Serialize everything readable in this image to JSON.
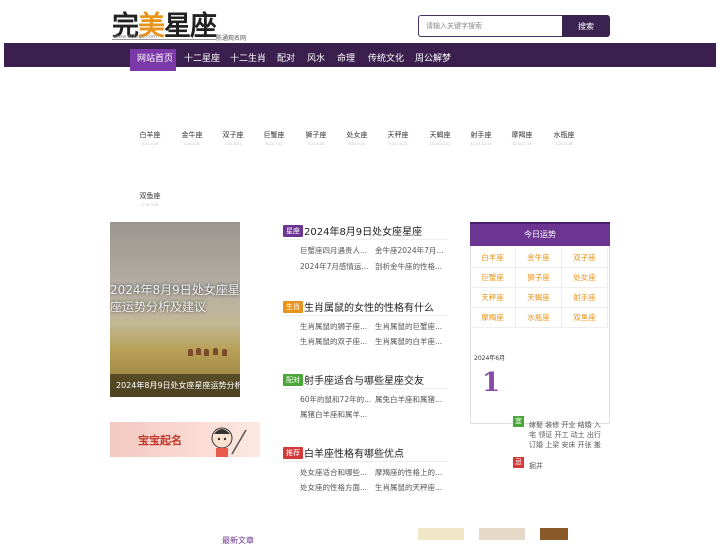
{
  "header": {
    "logo_left": "完",
    "logo_mid": "美",
    "logo_right": "星座",
    "logo_sub": "www.dubuju.com",
    "slogan": "陈通观名网",
    "search_placeholder": "请输入关键字搜索",
    "search_button": "搜索"
  },
  "nav": {
    "items": [
      "网站首页",
      "十二星座",
      "十二生肖",
      "配对",
      "风水",
      "命理",
      "传统文化",
      "周公解梦"
    ]
  },
  "zodiacs": [
    {
      "name": "白羊座",
      "date": "3.21-4.19"
    },
    {
      "name": "金牛座",
      "date": "4.20-5.20"
    },
    {
      "name": "双子座",
      "date": "5.21-6.21"
    },
    {
      "name": "巨蟹座",
      "date": "6.22-7.22"
    },
    {
      "name": "狮子座",
      "date": "7.23-8.22"
    },
    {
      "name": "处女座",
      "date": "8.23-9.22"
    },
    {
      "name": "天秤座",
      "date": "9.23-10.23"
    },
    {
      "name": "天蝎座",
      "date": "10.24-11.22"
    },
    {
      "name": "射手座",
      "date": "11.23-12.21"
    },
    {
      "name": "摩羯座",
      "date": "12.22-1.19"
    },
    {
      "name": "水瓶座",
      "date": "1.20-2.18"
    },
    {
      "name": "双鱼座",
      "date": "2.19-3.20"
    }
  ],
  "banner": {
    "big_text": "2024年8月9日处女座星座运势分析及建议",
    "caption": "2024年8月9日处女座星座运势分析及建议"
  },
  "ad": {
    "text": "宝宝起名"
  },
  "articles": [
    {
      "tag": "星座",
      "tag_color": "#6b3591",
      "title": "2024年8月9日处女座星座",
      "subs": [
        "巨蟹座四月遇贵人...",
        "金牛座2024年7月...",
        "2024年7月感情运...",
        "剖析金牛座的性格..."
      ]
    },
    {
      "tag": "生肖",
      "tag_color": "#e8941c",
      "title": "生肖属鼠的女性的性格有什么",
      "subs": [
        "生肖属鼠的狮子座...",
        "生肖属鼠的巨蟹座...",
        "生肖属鼠的双子座...",
        "生肖属鼠的白羊座..."
      ]
    },
    {
      "tag": "配对",
      "tag_color": "#4aa83a",
      "title": "射手座适合与哪些星座交友",
      "subs": [
        "60年的鼠和72年的...",
        "属兔白羊座和属猪...",
        "属猪白羊座和属羊..."
      ]
    },
    {
      "tag": "推荐",
      "tag_color": "#d23a3a",
      "title": "白羊座性格有哪些优点",
      "subs": [
        "处女座适合和哪些...",
        "摩羯座的性格上的...",
        "处女座的性格方面...",
        "生肖属鼠的天秤座..."
      ]
    }
  ],
  "fortune": {
    "title": "今日运势",
    "items": [
      "白羊座",
      "金牛座",
      "双子座",
      "巨蟹座",
      "狮子座",
      "处女座",
      "天秤座",
      "天蝎座",
      "射手座",
      "摩羯座",
      "水瓶座",
      "双鱼座"
    ]
  },
  "calendar": {
    "month": "2024年6月",
    "day": "1",
    "yi_label": "宜",
    "yi_text": "嫁娶 装修 开业 结婚 入宅 领证 开工 动土 出行 订婚 上梁 安床 开张 搬家",
    "ji_label": "忌",
    "ji_text": "掘井"
  },
  "latest": {
    "title": "最新文章"
  },
  "colors": {
    "brand": "#3a1f4f",
    "accent": "#7b3aa8",
    "orange": "#e8941c"
  }
}
